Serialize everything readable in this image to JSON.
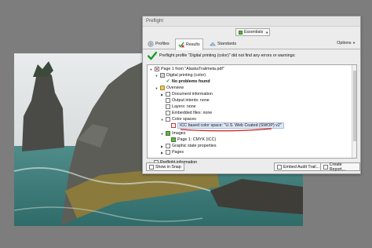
{
  "panel": {
    "title": "Preflight",
    "workspace": {
      "label": "Essentials"
    },
    "tabs": [
      {
        "label": "Profiles"
      },
      {
        "label": "Results"
      },
      {
        "label": "Standards"
      }
    ],
    "options_label": "Options",
    "result_message": "Preflight profile \"Digital printing (color)\" did not find any errors or warnings:",
    "tree": [
      {
        "text": "Page 1 from \"AlaskaTrailmeta.pdf\""
      },
      {
        "text": "Digital printing (color)"
      },
      {
        "text": "No problems found"
      },
      {
        "text": "Overview"
      },
      {
        "text": "Document information"
      },
      {
        "text": "Output intents: none"
      },
      {
        "text": "Layers: none"
      },
      {
        "text": "Embedded files: none"
      },
      {
        "text": "Color spaces"
      },
      {
        "text": "ICC based color space: \"U.S. Web Coated (SWOP) v2\""
      },
      {
        "text": "Images"
      },
      {
        "text": "Page 1: CMYK (ICC)"
      },
      {
        "text": "Graphic state properties"
      },
      {
        "text": "Pages"
      },
      {
        "text": "Preflight information"
      }
    ],
    "buttons": {
      "show_in_snap": "Show in Snap",
      "embed_audit_trail": "Embed Audit Trail...",
      "create_report": "Create Report..."
    }
  },
  "colors": {
    "accent_green": "#1a9a2e",
    "annotation_red": "#d21c1c",
    "background_gray": "#7d7d7d"
  }
}
